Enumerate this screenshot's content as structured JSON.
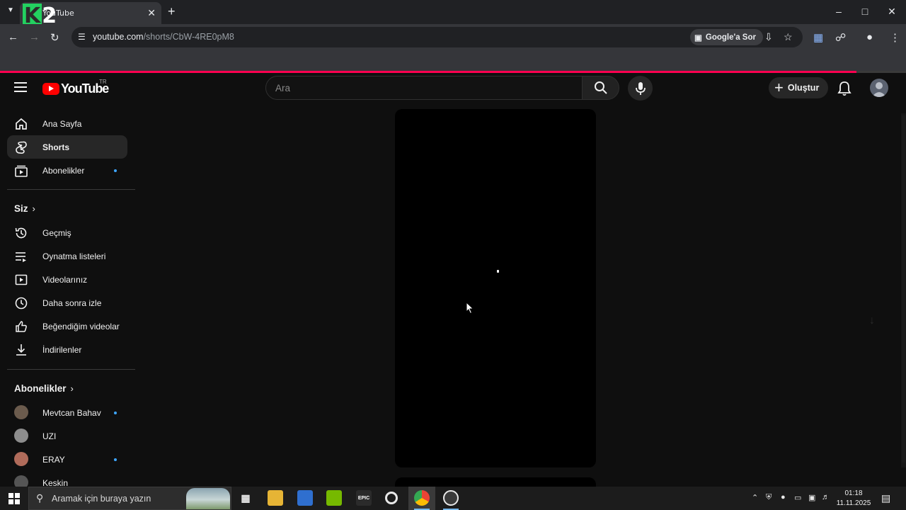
{
  "browser": {
    "tab_title": "YouTube",
    "overlay_logo_k": "K",
    "overlay_logo_2": "2",
    "url_host": "youtube.com",
    "url_path": "/shorts/CbW-4RE0pM8",
    "lens_label": "Google'a Sor"
  },
  "youtube": {
    "logo_text": "YouTube",
    "region": "TR",
    "search_placeholder": "Ara",
    "create_label": "Oluştur"
  },
  "sidebar": {
    "main_items": [
      {
        "label": "Ana Sayfa",
        "icon": "home-icon"
      },
      {
        "label": "Shorts",
        "icon": "shorts-icon",
        "active": true
      },
      {
        "label": "Abonelikler",
        "icon": "subscriptions-icon",
        "dot": true
      }
    ],
    "you_section": "Siz",
    "you_items": [
      {
        "label": "Geçmiş",
        "icon": "history-icon"
      },
      {
        "label": "Oynatma listeleri",
        "icon": "playlists-icon"
      },
      {
        "label": "Videolarınız",
        "icon": "your-videos-icon"
      },
      {
        "label": "Daha sonra izle",
        "icon": "watch-later-icon"
      },
      {
        "label": "Beğendiğim videolar",
        "icon": "liked-videos-icon"
      },
      {
        "label": "İndirilenler",
        "icon": "downloads-icon"
      }
    ],
    "subs_section": "Abonelikler",
    "channels": [
      {
        "label": "Mevtcan Bahav",
        "dot": true,
        "color": "#6b5b4d"
      },
      {
        "label": "UZI",
        "dot": false,
        "color": "#8d8d8d"
      },
      {
        "label": "ERAY",
        "dot": true,
        "color": "#b06b5a"
      },
      {
        "label": "Keskin",
        "dot": false,
        "color": "#555555"
      }
    ]
  },
  "taskbar": {
    "search_placeholder": "Aramak için buraya yazın",
    "time": "01:18",
    "date": "11.11.2025"
  },
  "colors": {
    "progress": "#ff0050",
    "youtube_red": "#ff0000",
    "accent_dot": "#3ea6ff"
  }
}
